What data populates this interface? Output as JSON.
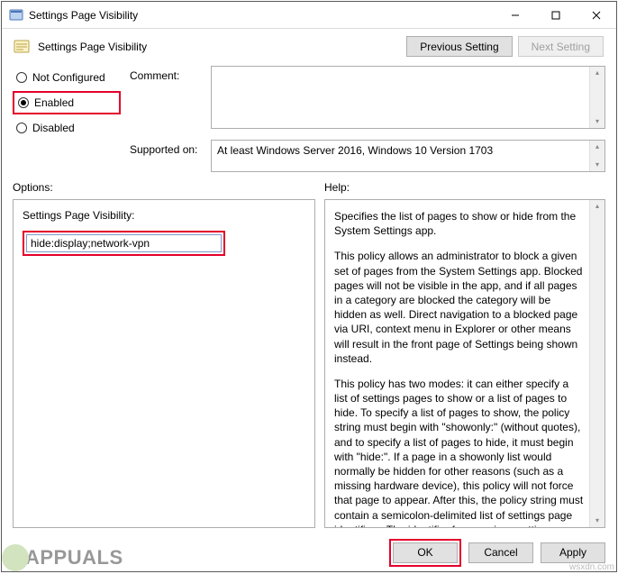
{
  "window": {
    "title": "Settings Page Visibility"
  },
  "header": {
    "title": "Settings Page Visibility",
    "prev_btn": "Previous Setting",
    "next_btn": "Next Setting"
  },
  "state": {
    "not_configured": "Not Configured",
    "enabled": "Enabled",
    "disabled": "Disabled",
    "selected": "enabled"
  },
  "meta": {
    "comment_label": "Comment:",
    "comment_value": "",
    "supported_label": "Supported on:",
    "supported_value": "At least Windows Server 2016, Windows 10 Version 1703"
  },
  "labels": {
    "options": "Options:",
    "help": "Help:"
  },
  "options": {
    "field_label": "Settings Page Visibility:",
    "field_value": "hide:display;network-vpn"
  },
  "help": {
    "p1": "Specifies the list of pages to show or hide from the System Settings app.",
    "p2": "This policy allows an administrator to block a given set of pages from the System Settings app. Blocked pages will not be visible in the app, and if all pages in a category are blocked the category will be hidden as well. Direct navigation to a blocked page via URI, context menu in Explorer or other means will result in the front page of Settings being shown instead.",
    "p3": "This policy has two modes: it can either specify a list of settings pages to show or a list of pages to hide. To specify a list of pages to show, the policy string must begin with \"showonly:\" (without quotes), and to specify a list of pages to hide, it must begin with \"hide:\". If a page in a showonly list would normally be hidden for other reasons (such as a missing hardware device), this policy will not force that page to appear. After this, the policy string must contain a semicolon-delimited list of settings page identifiers. The identifier for any given settings page is the published URI for that page, minus the \"ms-settings:\" protocol part."
  },
  "footer": {
    "ok": "OK",
    "cancel": "Cancel",
    "apply": "Apply"
  },
  "watermark": {
    "left": "APPUALS",
    "right": "wsxdn.com"
  }
}
